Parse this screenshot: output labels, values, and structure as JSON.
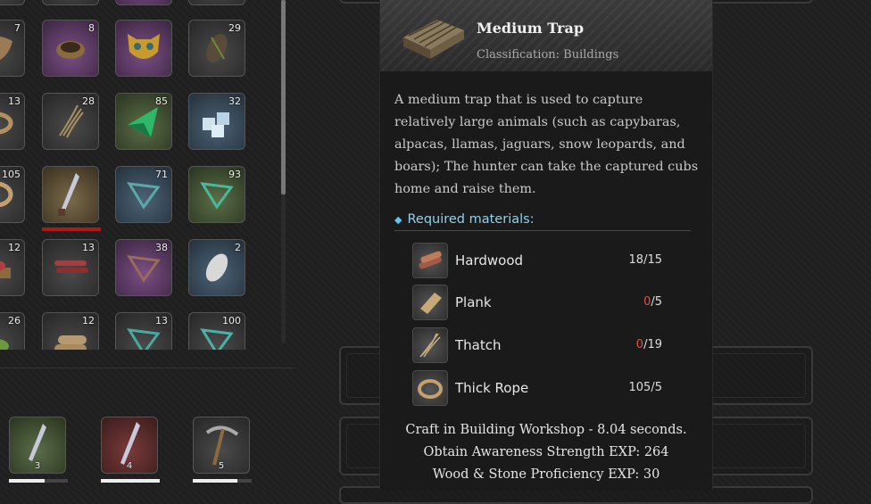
{
  "inventory": {
    "slots": [
      {
        "count": "7"
      },
      {
        "count": "8"
      },
      {
        "count": ""
      },
      {
        "count": "29"
      },
      {
        "count": "13"
      },
      {
        "count": "28"
      },
      {
        "count": "85"
      },
      {
        "count": "32"
      },
      {
        "count": "105"
      },
      {
        "count": ""
      },
      {
        "count": "71"
      },
      {
        "count": "93"
      },
      {
        "count": "12"
      },
      {
        "count": "13"
      },
      {
        "count": "38"
      },
      {
        "count": "2"
      },
      {
        "count": "26"
      },
      {
        "count": "12"
      },
      {
        "count": "13"
      },
      {
        "count": "100"
      }
    ]
  },
  "hotbar": {
    "slots": [
      {
        "count": "3",
        "durability": 0.6
      },
      {
        "count": "4",
        "durability": 1.0
      },
      {
        "count": "5",
        "durability": 0.75
      }
    ]
  },
  "tooltip": {
    "title": "Medium Trap",
    "classification": "Classification: Buildings",
    "description": "A medium trap that is used to capture relatively large animals (such as capybaras, alpacas, llamas, jaguars, snow leopards, and boars); The hunter can take the captured cubs home and raise them.",
    "required_label": "Required materials:",
    "materials": [
      {
        "name": "Hardwood",
        "have": "18",
        "need": "/15",
        "short": false
      },
      {
        "name": "Plank",
        "have": "0",
        "need": "/5",
        "short": true
      },
      {
        "name": "Thatch",
        "have": "0",
        "need": "/19",
        "short": true
      },
      {
        "name": "Thick Rope",
        "have": "105",
        "need": "/5",
        "short": false
      }
    ],
    "footer": [
      "Craft in Building Workshop - 8.04 seconds.",
      "Obtain Awareness Strength EXP: 264",
      "Wood & Stone Proficiency EXP: 30"
    ]
  },
  "colors": {
    "accent_cyan": "#8fd3ec",
    "shortage_red": "#e0533f",
    "selection_red": "#b01818"
  }
}
